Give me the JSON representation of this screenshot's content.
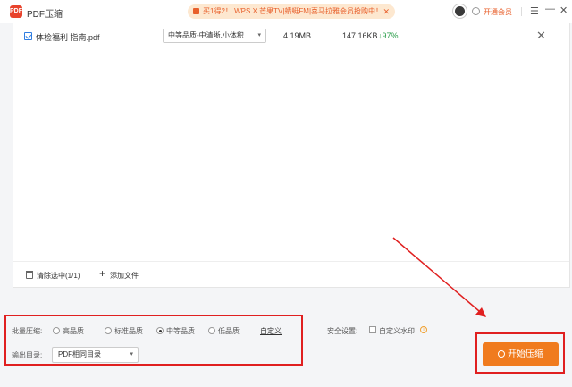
{
  "titlebar": {
    "logo_text": "PDF",
    "title": "PDF压缩",
    "promo_text": "买1得2！ WPS X 芒果TV|蜻蜓FM|喜马拉雅会员抢购中！",
    "promo_close": "✕",
    "vip_text": "开通会员",
    "menu_icon": "☰",
    "min_icon": "—",
    "close_icon": "✕"
  },
  "file_list": {
    "rows": [
      {
        "checked": true,
        "name": "体检福利 指南.pdf",
        "quality": "中等品质-中清晰,小体积",
        "original_size": "4.19MB",
        "compressed_size": "147.16KB",
        "ratio": "↓97%",
        "remove_icon": "✕"
      }
    ],
    "footer": {
      "clear_label": "清除选中(1/1)",
      "add_icon": "+",
      "add_label": "添加文件"
    }
  },
  "settings": {
    "batch_label": "批量压缩:",
    "options": [
      "高品质",
      "标准品质",
      "中等品质",
      "低品质"
    ],
    "selected_option": "中等品质",
    "custom_label": "自定义",
    "output_label": "输出目录:",
    "output_value": "PDF相同目录",
    "security_label": "安全设置:",
    "watermark_label": "自定义水印",
    "watermark_checked": false
  },
  "start_button": {
    "label": "开始压缩"
  },
  "colors": {
    "accent": "#f07b1e",
    "highlight_red": "#e02020",
    "ratio_green": "#2a9d4a",
    "link_blue": "#2f7de1"
  }
}
